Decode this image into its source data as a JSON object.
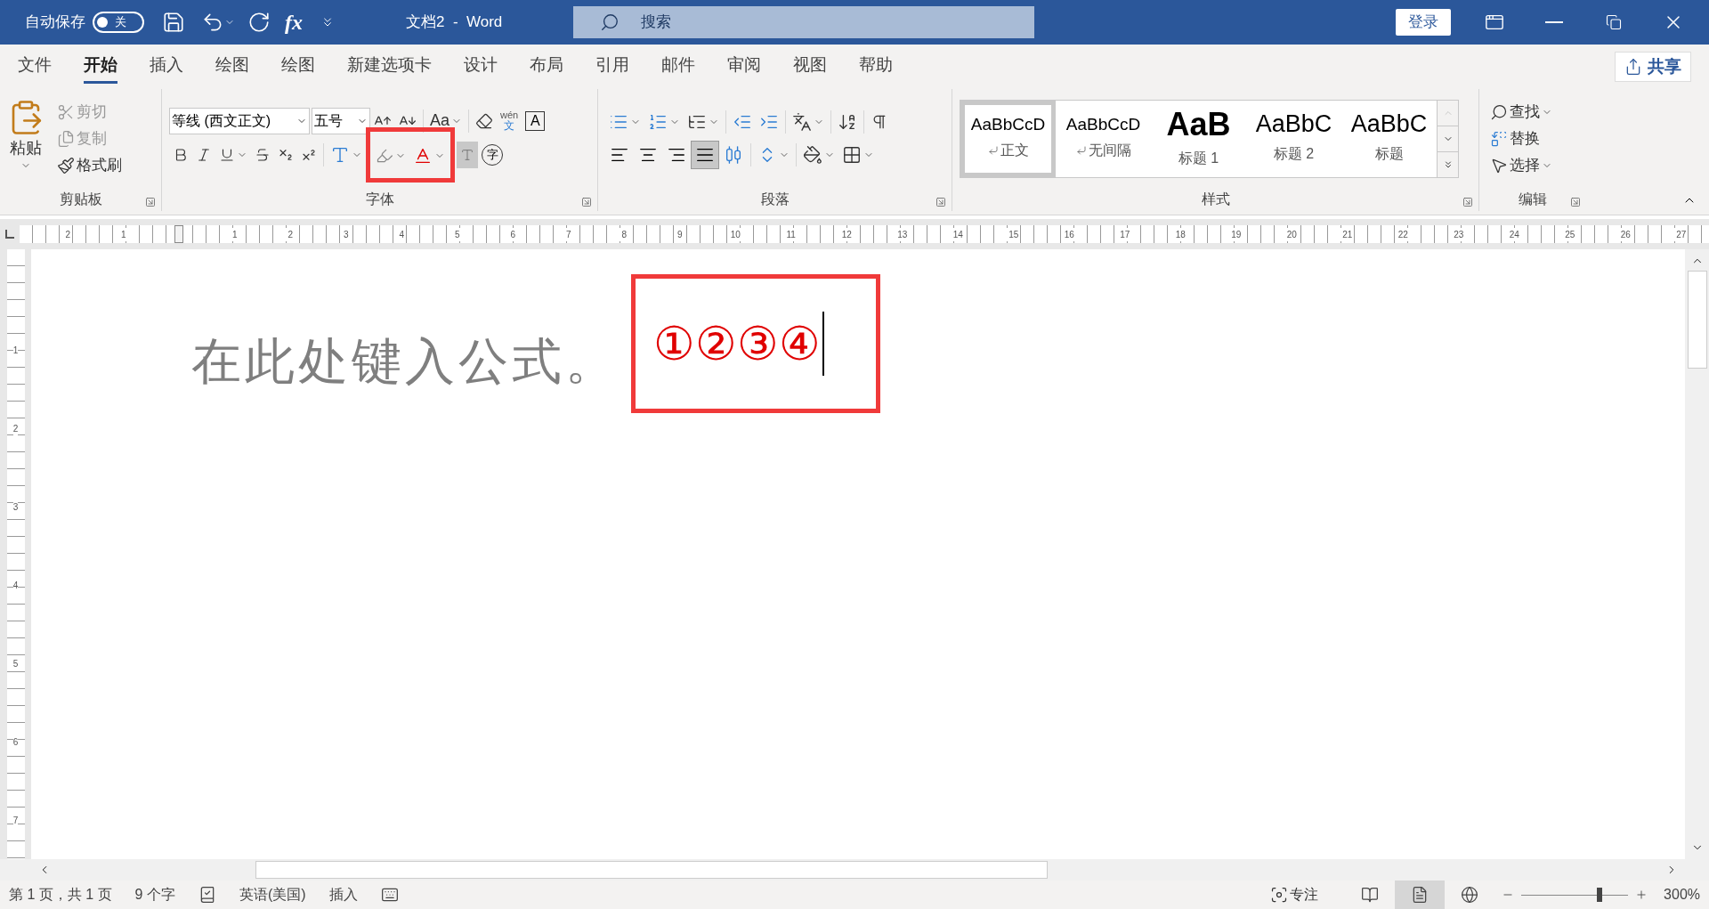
{
  "title_bar": {
    "autosave_label": "自动保存",
    "autosave": {
      "on": false,
      "label": "关"
    },
    "formula": "fx",
    "document_title": "文档2  -  Word",
    "search": {
      "placeholder": "搜索"
    },
    "sign_in": "登录"
  },
  "tabs": [
    {
      "label": "文件",
      "selected": false
    },
    {
      "label": "开始",
      "selected": true
    },
    {
      "label": "插入",
      "selected": false
    },
    {
      "label": "绘图",
      "selected": false
    },
    {
      "label": "绘图",
      "selected": false
    },
    {
      "label": "新建选项卡",
      "selected": false
    },
    {
      "label": "设计",
      "selected": false
    },
    {
      "label": "布局",
      "selected": false
    },
    {
      "label": "引用",
      "selected": false
    },
    {
      "label": "邮件",
      "selected": false
    },
    {
      "label": "审阅",
      "selected": false
    },
    {
      "label": "视图",
      "selected": false
    },
    {
      "label": "帮助",
      "selected": false
    }
  ],
  "share": "共享",
  "clipboard": {
    "paste": "粘贴",
    "cut": "剪切",
    "copy": "复制",
    "format_painter": "格式刷",
    "group": "剪贴板"
  },
  "font": {
    "name": "等线 (西文正文)",
    "size": "五号",
    "change_case": "Aa",
    "phonetic_top": "wén",
    "phonetic_bottom": "文",
    "char_border": "A",
    "enclosed": "字",
    "group": "字体"
  },
  "paragraph": {
    "group": "段落",
    "alignment": [
      {
        "kind": "left",
        "selected": false
      },
      {
        "kind": "center",
        "selected": false
      },
      {
        "kind": "right",
        "selected": false
      },
      {
        "kind": "justify",
        "selected": true
      },
      {
        "kind": "distributed",
        "selected": false
      }
    ]
  },
  "styles": {
    "group": "样式",
    "items": [
      {
        "kind": "normal",
        "sample": "AaBbCcD",
        "label": "正文",
        "selected": true
      },
      {
        "kind": "normal",
        "sample": "AaBbCcD",
        "label": "无间隔",
        "selected": false
      },
      {
        "kind": "heading1",
        "sample": "AaB",
        "label": "标题 1",
        "selected": false
      },
      {
        "kind": "heading2",
        "sample": "AaBbC",
        "label": "标题 2",
        "selected": false
      },
      {
        "kind": "title",
        "sample": "AaBbC",
        "label": "标题",
        "selected": false
      }
    ]
  },
  "editing": {
    "group": "编辑",
    "find": "查找",
    "replace": "替换",
    "select": "选择"
  },
  "ruler": {
    "left_labels": [
      "2",
      "1"
    ],
    "right_labels": [
      "1",
      "2",
      "3",
      "4",
      "5",
      "6",
      "7",
      "8",
      "9",
      "10",
      "11",
      "12",
      "13",
      "14",
      "15",
      "16",
      "17",
      "18",
      "19",
      "20",
      "21",
      "22",
      "23",
      "24",
      "25",
      "26",
      "27"
    ],
    "vertical_labels": [
      "1",
      "2",
      "3",
      "4",
      "5",
      "6",
      "7"
    ]
  },
  "document": {
    "text": "在此处键入公式。",
    "highlighted": "①②③④"
  },
  "status_bar": {
    "page": "第 1 页，共 1 页",
    "words": "9 个字",
    "language": "英语(美国)",
    "mode": "插入",
    "focus": "专注",
    "views": [
      {
        "kind": "read",
        "selected": false
      },
      {
        "kind": "print",
        "selected": true
      },
      {
        "kind": "web",
        "selected": false
      }
    ],
    "zoom": {
      "level": 0.73
    },
    "zoom_reading": "300%"
  }
}
